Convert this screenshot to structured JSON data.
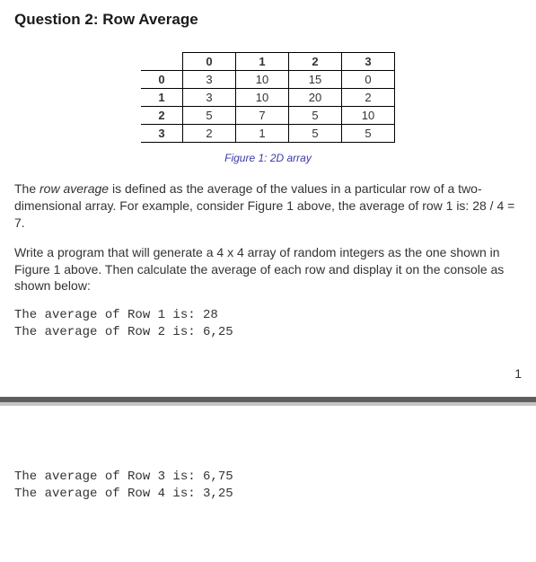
{
  "title": "Question 2: Row Average",
  "table": {
    "col_headers": [
      "0",
      "1",
      "2",
      "3"
    ],
    "row_headers": [
      "0",
      "1",
      "2",
      "3"
    ],
    "rows": [
      [
        "3",
        "10",
        "15",
        "0"
      ],
      [
        "3",
        "10",
        "20",
        "2"
      ],
      [
        "5",
        "7",
        "5",
        "10"
      ],
      [
        "2",
        "1",
        "5",
        "5"
      ]
    ]
  },
  "caption": "Figure 1: 2D array",
  "para1": {
    "lead_italic": "row average",
    "pre": "The ",
    "post": " is defined as the average of the values in a particular row of a two-dimensional array. For example, consider Figure 1 above, the average of row 1 is: 28 / 4 = 7."
  },
  "para2": "Write a program that will generate a 4 x 4 array of random integers as the one shown in Figure 1 above. Then calculate the average of each row and display it on the console as shown below:",
  "code_top_lines": [
    "The average of Row 1 is: 28",
    "The average of Row 2 is: 6,25"
  ],
  "page_number": "1",
  "code_bottom_lines": [
    "The average of Row 3 is: 6,75",
    "The average of Row 4 is: 3,25"
  ],
  "chart_data": {
    "type": "table",
    "title": "Figure 1: 2D array",
    "col_labels": [
      "0",
      "1",
      "2",
      "3"
    ],
    "row_labels": [
      "0",
      "1",
      "2",
      "3"
    ],
    "values": [
      [
        3,
        10,
        15,
        0
      ],
      [
        3,
        10,
        20,
        2
      ],
      [
        5,
        7,
        5,
        10
      ],
      [
        2,
        1,
        5,
        5
      ]
    ]
  }
}
